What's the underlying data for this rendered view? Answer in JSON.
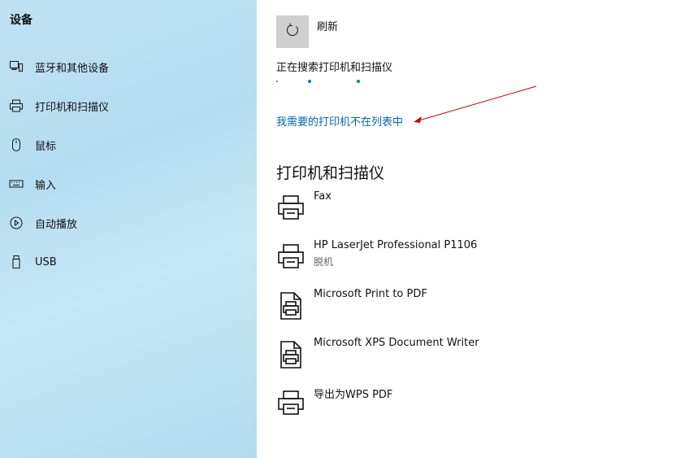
{
  "sidebar": {
    "title": "设备",
    "items": [
      {
        "label": "蓝牙和其他设备",
        "icon": "bluetooth-devices-icon"
      },
      {
        "label": "打印机和扫描仪",
        "icon": "printer-icon"
      },
      {
        "label": "鼠标",
        "icon": "mouse-icon"
      },
      {
        "label": "输入",
        "icon": "keyboard-icon"
      },
      {
        "label": "自动播放",
        "icon": "autoplay-icon"
      },
      {
        "label": "USB",
        "icon": "usb-icon"
      }
    ]
  },
  "main": {
    "refresh_label": "刷新",
    "refresh_icon": "refresh-icon",
    "searching_text": "正在搜索打印机和扫描仪",
    "missing_link": "我需要的打印机不在列表中",
    "section_title": "打印机和扫描仪",
    "printers": [
      {
        "name": "Fax",
        "status": "",
        "icon": "printer-icon"
      },
      {
        "name": "HP LaserJet Professional P1106",
        "status": "脱机",
        "icon": "printer-icon"
      },
      {
        "name": "Microsoft Print to PDF",
        "status": "",
        "icon": "document-printer-icon"
      },
      {
        "name": "Microsoft XPS Document Writer",
        "status": "",
        "icon": "document-printer-icon"
      },
      {
        "name": "导出为WPS PDF",
        "status": "",
        "icon": "printer-icon"
      }
    ]
  },
  "colors": {
    "link": "#0067b8",
    "accent": "#0078d7",
    "annotation_arrow": "#d00000",
    "sidebar_bg": "#b8dff1"
  }
}
